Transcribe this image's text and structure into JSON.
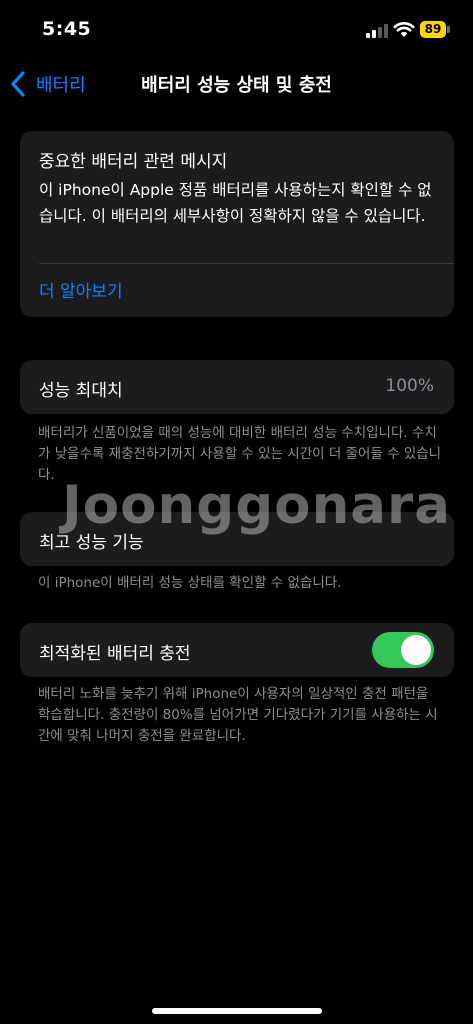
{
  "status_bar": {
    "time": "5:45",
    "battery_level": "89",
    "battery_color": "#ffd60a",
    "icons": [
      "cellular-signal-icon",
      "wifi-icon",
      "battery-icon"
    ]
  },
  "nav": {
    "back_label": "배터리",
    "title": "배터리 성능 상태 및 충전"
  },
  "alert": {
    "title": "중요한 배터리 관련 메시지",
    "body": "이 iPhone이 Apple 정품 배터리를 사용하는지 확인할 수 없습니다. 이 배터리의 세부사항이 정확하지 않을 수 있습니다.",
    "link": "더 알아보기"
  },
  "max_capacity": {
    "label": "성능 최대치",
    "value": "100%",
    "footnote": "배터리가 신품이었을 때의 성능에 대비한 배터리 성능 수치입니다. 수치가 낮을수록 재충전하기까지 사용할 수 있는 시간이 더 줄어들 수 있습니다."
  },
  "peak_performance": {
    "label": "최고 성능 기능",
    "footnote": "이 iPhone이 배터리 성능 상태를 확인할 수 없습니다."
  },
  "optimized_charging": {
    "label": "최적화된 배터리 충전",
    "enabled": true,
    "toggle_color": "#34c759",
    "footnote": "배터리 노화를 늦추기 위해 iPhone이 사용자의 일상적인 충전 패턴을 학습합니다. 충전량이 80%를 넘어가면 기다렸다가 기기를 사용하는 시간에 맞춰 나머지 충전을 완료합니다."
  },
  "watermark": "Joonggonara",
  "colors": {
    "accent": "#0a84ff",
    "card_bg": "#1c1c1e",
    "secondary_text": "#8e8e93"
  }
}
